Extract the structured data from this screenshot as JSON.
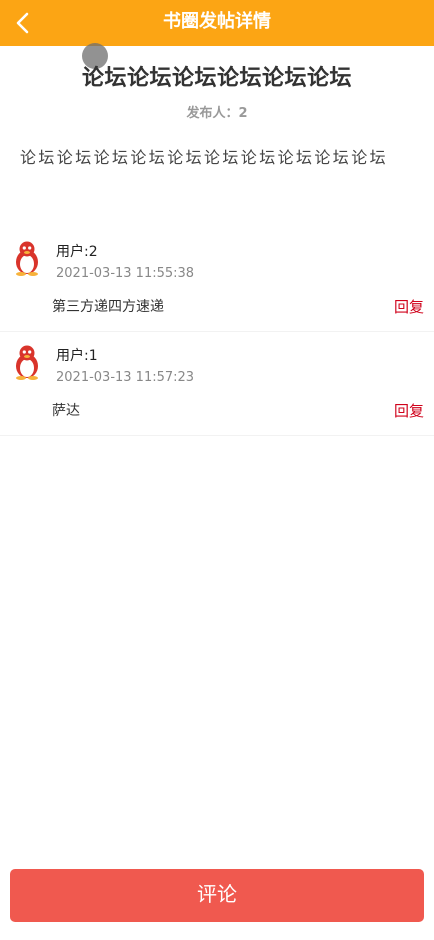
{
  "header": {
    "title": "书圈发帖详情",
    "back_icon": "chevron-left-icon",
    "bg_color": "#fca514"
  },
  "post": {
    "title": "论坛论坛论坛论坛论坛论坛",
    "author": "发布人：2",
    "body": "论坛论坛论坛论坛论坛论坛论坛论坛论坛论坛"
  },
  "comments": [
    {
      "avatar_icon": "penguin-icon",
      "user": "用户:2",
      "time": "2021-03-13 11:55:38",
      "text": "第三方递四方速递",
      "reply_label": "回复"
    },
    {
      "avatar_icon": "penguin-icon",
      "user": "用户:1",
      "time": "2021-03-13 11:57:23",
      "text": "萨达",
      "reply_label": "回复"
    }
  ],
  "footer": {
    "comment_button_label": "评论",
    "button_color": "#f0594f"
  }
}
